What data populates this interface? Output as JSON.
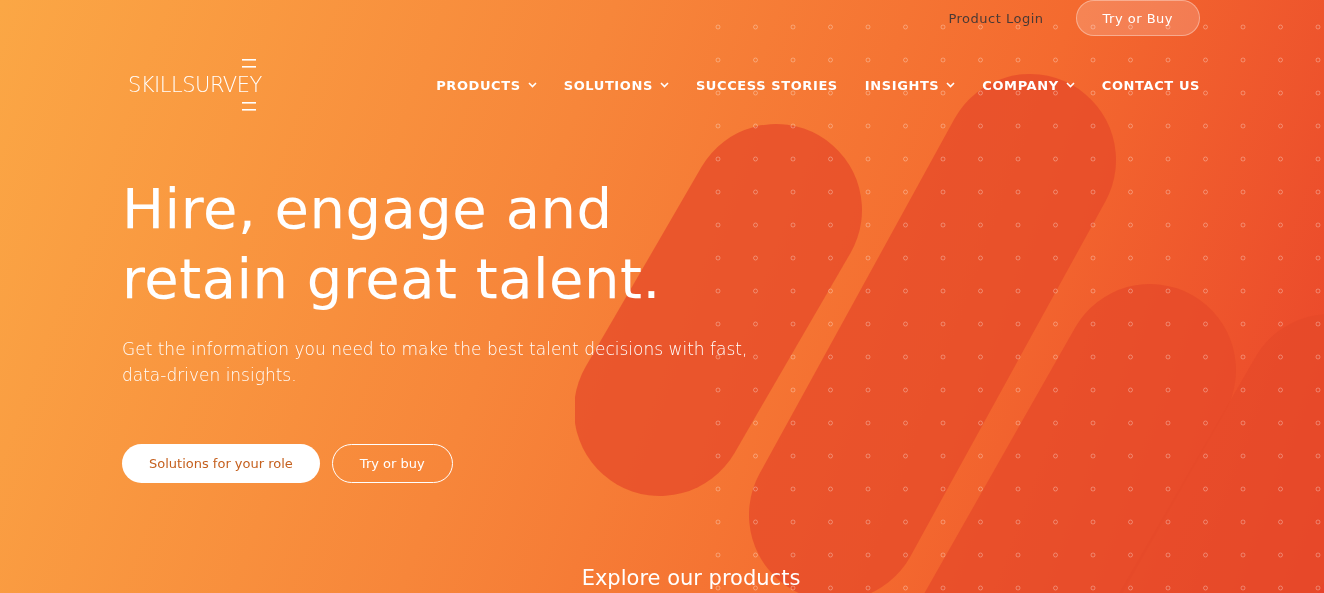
{
  "top_bar": {
    "login_link": "Product Login",
    "cta_button": "Try or Buy"
  },
  "logo": {
    "text": "SKILLSURVEY"
  },
  "nav": [
    {
      "label": "PRODUCTS",
      "has_dropdown": true
    },
    {
      "label": "SOLUTIONS",
      "has_dropdown": true
    },
    {
      "label": "SUCCESS STORIES",
      "has_dropdown": false
    },
    {
      "label": "INSIGHTS",
      "has_dropdown": true
    },
    {
      "label": "COMPANY",
      "has_dropdown": true
    },
    {
      "label": "CONTACT US",
      "has_dropdown": false
    }
  ],
  "hero": {
    "headline_lines": [
      "Hire, engage and",
      "retain great talent."
    ],
    "subtitle": "Get the information you need to make the best talent decisions with fast, data-driven insights.",
    "buttons": [
      {
        "label": "Solutions for your role",
        "kind": "filled"
      },
      {
        "label": "Try or buy",
        "kind": "outline"
      }
    ]
  },
  "section_heading": "Explore our products"
}
